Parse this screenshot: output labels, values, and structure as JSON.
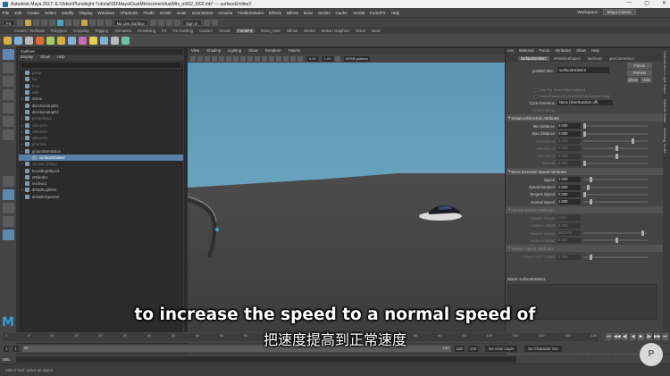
{
  "window": {
    "title": "Autodesk Maya 2017: E:\\Video\\Pluralsight-Tutorial\\3D\\Maya\\DustMtx\\scenes\\dustMtx_m002_t002.mb*   ---   surfaceEmitter2",
    "controls": [
      "—",
      "▢",
      "✕"
    ]
  },
  "menubar": {
    "items": [
      "File",
      "Edit",
      "Create",
      "Select",
      "Modify",
      "Display",
      "Windows",
      "nParticles",
      "Fluids",
      "nCloth",
      "nHair",
      "nConstraint",
      "nCache",
      "Fields/Solvers",
      "Effects",
      "Bifrost",
      "Boss",
      "MASH",
      "Cache",
      "Arnold",
      "FumeFX",
      "Help"
    ],
    "workspace_label": "Workspace :",
    "workspace_value": "Maya Classic"
  },
  "statusline": {
    "mode": "FX",
    "surface": "No Live Surface",
    "signin": "Sign In"
  },
  "shelf": {
    "tabs": [
      "Curves / Surfaces",
      "Polygons",
      "Sculpting",
      "Rigging",
      "Animation",
      "Rendering",
      "FX",
      "FX Caching",
      "Custom",
      "Arnold",
      "FumeFX",
      "XGen_User",
      "Bifrost",
      "MASH",
      "Motion Graphics",
      "XGen",
      "Boss"
    ],
    "active_tab": "FumeFX",
    "icon_colors": [
      "#d6b040",
      "#7fb2d9",
      "#b9b9b9",
      "#e06a3c",
      "#9ecf5e",
      "#d6b040",
      "#7fb2d9",
      "#c66fb0",
      "#e0d24a",
      "#7fb2d9",
      "#b9b9b9",
      "#6ac3a4"
    ]
  },
  "outliner": {
    "title": "Outliner",
    "menu": [
      "Display",
      "Show",
      "Help"
    ],
    "items": [
      {
        "label": "persp",
        "dim": true,
        "expand": ""
      },
      {
        "label": "top",
        "dim": true,
        "expand": ""
      },
      {
        "label": "front",
        "dim": true,
        "expand": ""
      },
      {
        "label": "side",
        "dim": true,
        "expand": ""
      },
      {
        "label": "scene",
        "dim": false,
        "expand": "+"
      },
      {
        "label": "directionalLight1",
        "dim": false,
        "expand": ""
      },
      {
        "label": "directionalLight2",
        "dim": false,
        "expand": ""
      },
      {
        "label": "perspShape",
        "dim": true,
        "expand": "+"
      },
      {
        "label": "vdbcache",
        "dim": true,
        "expand": "+"
      },
      {
        "label": "vdbcache",
        "dim": true,
        "expand": "+"
      },
      {
        "label": "vdbcache",
        "dim": true,
        "expand": "+"
      },
      {
        "label": "pParticle",
        "dim": true,
        "expand": "+"
      },
      {
        "label": "groundInteraction",
        "dim": false,
        "expand": "−"
      },
      {
        "label": "surfaceEmitter2",
        "dim": false,
        "expand": "",
        "selected": true
      },
      {
        "label": "camera_Shape",
        "dim": true,
        "expand": "+"
      },
      {
        "label": "boundingObject1",
        "dim": false,
        "expand": ""
      },
      {
        "label": "nRdiode1",
        "dim": false,
        "expand": ""
      },
      {
        "label": "nucleus1",
        "dim": false,
        "expand": ""
      },
      {
        "label": "defaultLightSet",
        "dim": false,
        "expand": "+"
      },
      {
        "label": "defaultObjectSet",
        "dim": false,
        "expand": ""
      }
    ]
  },
  "viewport": {
    "menu": [
      "View",
      "Shading",
      "Lighting",
      "Show",
      "Renderer",
      "Panels"
    ],
    "fields": [
      "0.00",
      "1.00"
    ],
    "colorspace": "sRGB gamma"
  },
  "attribute_editor": {
    "menu": [
      "List",
      "Selected",
      "Focus",
      "Attributes",
      "Show",
      "Help"
    ],
    "tabs": [
      "surfaceEmitter2",
      "nParticleShape2",
      "nucleus2",
      "geoConnector1"
    ],
    "node_label": "pointEmitter:",
    "node_value": "surfaceEmitter2",
    "buttons": {
      "focus": "Focus",
      "presets": "Presets",
      "show": "Show",
      "hide": "Hide"
    },
    "checks": [
      "Use Per-Point Rates (object)",
      "Need Parent UV (NURBS/Poly surface only)"
    ],
    "cycle_label": "Cycle Emission",
    "cycle_value": "None (timeRandom off)",
    "cycle_interval_label": "Cycle Interval",
    "sections": {
      "distance": "Distance/Direction Attributes",
      "basic_speed": "Basic Emission Speed Attributes",
      "volume_emitter": "Volume Emitter Attributes",
      "volume_speed": "Volume Speed Attributes"
    },
    "distance_rows": [
      {
        "label": "Min Distance",
        "value": "0.000",
        "dim": false,
        "knob": 0.0
      },
      {
        "label": "Max Distance",
        "value": "0.000",
        "dim": false,
        "knob": 0.0
      },
      {
        "label": "Direction X",
        "value": "1.000",
        "dim": true,
        "knob": 0.75
      },
      {
        "label": "Direction Y",
        "value": "0.000",
        "dim": true,
        "knob": 0.5
      },
      {
        "label": "Direction Z",
        "value": "0.000",
        "dim": true,
        "knob": 0.5
      },
      {
        "label": "Spread",
        "value": "0.000",
        "dim": true,
        "knob": 0.0
      }
    ],
    "speed_rows": [
      {
        "label": "Speed",
        "value": "1.000",
        "dim": false,
        "knob": 0.1
      },
      {
        "label": "Speed Random",
        "value": "0.500",
        "dim": false,
        "knob": 0.05
      },
      {
        "label": "Tangent Speed",
        "value": "0.000",
        "dim": false,
        "knob": 0.0
      },
      {
        "label": "Normal Speed",
        "value": "1.000",
        "dim": false,
        "knob": 0.1
      }
    ],
    "volume_rows": [
      {
        "label": "Volume Shape",
        "value": "Cube",
        "dim": true,
        "knob": null
      },
      {
        "label": "Volume Offset",
        "value": "0.000",
        "dim": true,
        "knob": null
      },
      {
        "label": "Volume Sweep",
        "value": "360.000",
        "dim": true,
        "knob": 0.9
      },
      {
        "label": "Section Radius",
        "value": "0.500",
        "dim": true,
        "knob": 0.5
      }
    ],
    "volume_speed_rows": [
      {
        "label": "Away From Center",
        "value": "1.000",
        "dim": true,
        "knob": 0.1
      }
    ],
    "notes_label": "Notes:  surfaceEmitter2",
    "bottom_buttons": [
      "Select",
      "Load Attributes",
      "Copy Tab"
    ]
  },
  "side_tabs": [
    "Channel Box / Layer Editor",
    "Attribute Editor",
    "Modeling Toolkit"
  ],
  "timeslider": {
    "ticks": [
      "1",
      "5",
      "10",
      "15",
      "20",
      "25",
      "30",
      "35",
      "40",
      "45",
      "50",
      "55",
      "60",
      "65",
      "70",
      "75",
      "80",
      "85",
      "90",
      "95",
      "100",
      "105",
      "110",
      "115",
      "120"
    ],
    "current_frame": "1",
    "playback_buttons": [
      "⏮",
      "◀◀",
      "◀|",
      "◀",
      "▶",
      "|▶",
      "▶▶",
      "⏭"
    ]
  },
  "rangeslider": {
    "start": "1",
    "inner_start": "1",
    "bar_start": "29",
    "bar_end": "120",
    "inner_end": "120",
    "end": "120",
    "anim_layer": "No Anim Layer",
    "char_set": "No Character Set"
  },
  "cmdline": {
    "label": "MEL"
  },
  "helpline": {
    "text": "Select Tool: select an object"
  },
  "subtitles": {
    "en": "to increase the speed to a normal speed of",
    "zh": "把速度提高到正常速度"
  },
  "watermark": {
    "text": "P"
  }
}
